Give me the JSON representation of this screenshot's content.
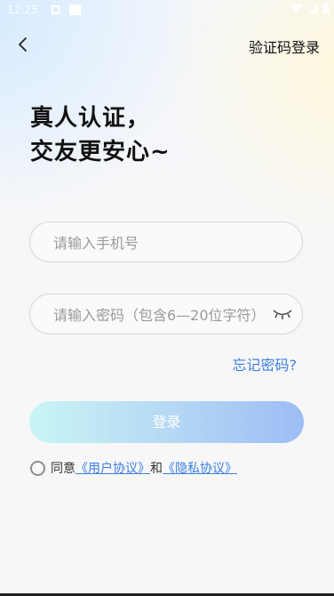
{
  "status": {
    "time": "12:25"
  },
  "nav": {
    "right_label": "验证码登录"
  },
  "headline": {
    "line1": "真人认证，",
    "line2": "交友更安心~"
  },
  "phone_field": {
    "placeholder": "请输入手机号",
    "value": ""
  },
  "password_field": {
    "placeholder": "请输入密码（包含6—20位字符）",
    "value": ""
  },
  "forgot_label": "忘记密码?",
  "login_label": "登录",
  "agreement": {
    "prefix": "同意",
    "user_agreement": "《用户协议》",
    "and": "和",
    "privacy_agreement": "《隐私协议》"
  },
  "icons": {
    "back": "chevron-left-icon",
    "eye": "eye-closed-icon",
    "radio": "radio-unchecked-icon"
  },
  "colors": {
    "link": "#3d7fe0",
    "button_start": "#c9f5f5",
    "button_end": "#9bbdf5"
  }
}
